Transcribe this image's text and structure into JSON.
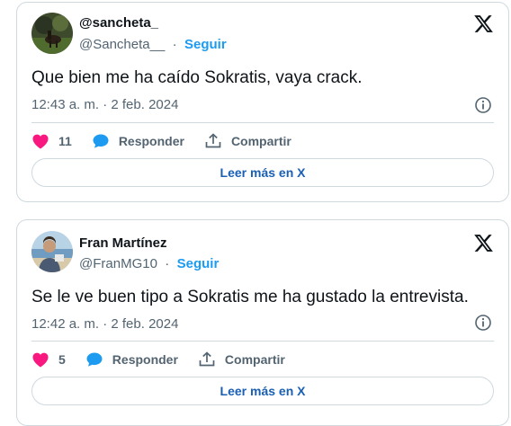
{
  "tweets": [
    {
      "name": "@sancheta_",
      "handle": "@Sancheta__",
      "separator": "·",
      "follow_label": "Seguir",
      "text": "Que bien me ha caído Sokratis, vaya crack.",
      "timestamp": "12:43 a. m. · 2 feb. 2024",
      "like_count": "11",
      "reply_label": "Responder",
      "share_label": "Compartir",
      "read_more_label": "Leer más en X"
    },
    {
      "name": "Fran Martínez",
      "handle": "@FranMG10",
      "separator": "·",
      "follow_label": "Seguir",
      "text": "Se le ve buen tipo a Sokratis me ha gustado la entrevista.",
      "timestamp": "12:42 a. m. · 2 feb. 2024",
      "like_count": "5",
      "reply_label": "Responder",
      "share_label": "Compartir",
      "read_more_label": "Leer más en X"
    }
  ],
  "colors": {
    "like": "#f91880",
    "reply": "#1d9bf0",
    "link": "#1d9bf0",
    "muted": "#536471",
    "border": "#cfd9de"
  },
  "icons": [
    "avatar",
    "x-logo-icon",
    "info-icon",
    "heart-icon",
    "reply-bubble-icon",
    "share-icon"
  ]
}
